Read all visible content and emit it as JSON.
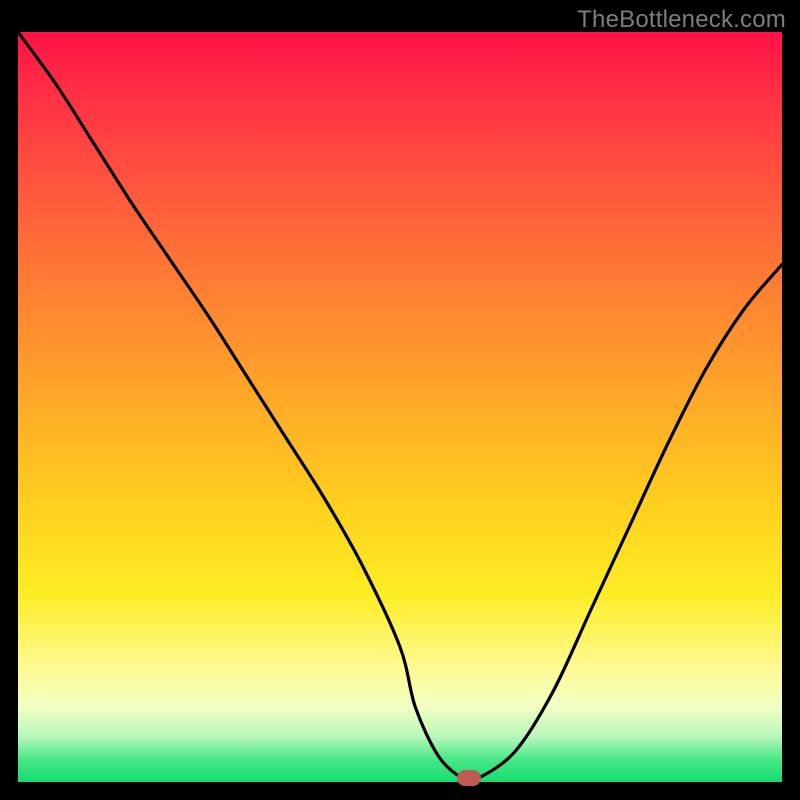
{
  "watermark": "TheBottleneck.com",
  "colors": {
    "curve_stroke": "#000000",
    "marker_fill": "#c15a55",
    "background": "#000000"
  },
  "chart_data": {
    "type": "line",
    "title": "",
    "xlabel": "",
    "ylabel": "",
    "xlim": [
      0,
      100
    ],
    "ylim": [
      0,
      100
    ],
    "grid": false,
    "x": [
      0,
      5,
      10,
      15,
      20,
      25,
      30,
      35,
      40,
      45,
      50,
      52,
      55,
      58,
      60,
      65,
      70,
      75,
      80,
      85,
      90,
      95,
      100
    ],
    "values": [
      100,
      93,
      85,
      77,
      69.5,
      62,
      54,
      46,
      38,
      29,
      18,
      10,
      3.5,
      0.6,
      0.4,
      4,
      12,
      23,
      34,
      45,
      55,
      63,
      69
    ],
    "marker": {
      "x": 59,
      "y": 0.5
    },
    "annotations": []
  }
}
